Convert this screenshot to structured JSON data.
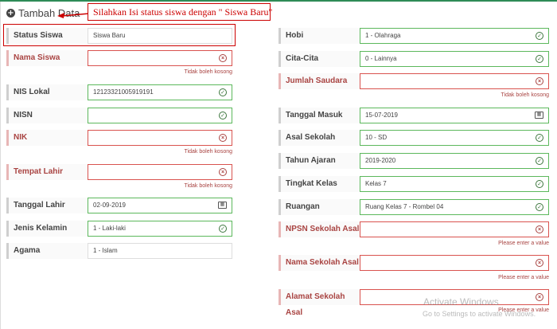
{
  "header": {
    "title": "Tambah Data",
    "icon": "plus-circle-icon"
  },
  "callout": {
    "text": "Silahkan Isi status siswa dengan \" Siswa Baru\""
  },
  "left": {
    "status_siswa": {
      "label": "Status Siswa",
      "value": "Siswa Baru"
    },
    "nama_siswa": {
      "label": "Nama Siswa",
      "value": "",
      "help": "Tidak boleh kosong"
    },
    "nis_lokal": {
      "label": "NIS Lokal",
      "value": "12123321005919191"
    },
    "nisn": {
      "label": "NISN",
      "value": ""
    },
    "nik": {
      "label": "NIK",
      "value": "",
      "help": "Tidak boleh kosong"
    },
    "tempat_lahir": {
      "label": "Tempat Lahir",
      "value": "",
      "help": "Tidak boleh kosong"
    },
    "tanggal_lahir": {
      "label": "Tanggal Lahir",
      "value": "02-09-2019"
    },
    "jenis_kelamin": {
      "label": "Jenis Kelamin",
      "value": "1 - Laki-laki"
    },
    "agama": {
      "label": "Agama",
      "value": "1 - Islam"
    }
  },
  "right": {
    "hobi": {
      "label": "Hobi",
      "value": "1 - Olahraga"
    },
    "cita_cita": {
      "label": "Cita-Cita",
      "value": "0 - Lainnya"
    },
    "jumlah_saudara": {
      "label": "Jumlah Saudara",
      "value": "",
      "help": "Tidak boleh kosong"
    },
    "tanggal_masuk": {
      "label": "Tanggal Masuk",
      "value": "15-07-2019"
    },
    "asal_sekolah": {
      "label": "Asal Sekolah",
      "value": "10 - SD"
    },
    "tahun_ajaran": {
      "label": "Tahun Ajaran",
      "value": "2019-2020"
    },
    "tingkat_kelas": {
      "label": "Tingkat Kelas",
      "value": "Kelas 7"
    },
    "ruangan": {
      "label": "Ruangan",
      "value": "Ruang Kelas 7 - Rombel 04"
    },
    "npsn_sekolah_asal": {
      "label": "NPSN Sekolah Asal",
      "value": "",
      "help": "Please enter a value"
    },
    "nama_sekolah_asal": {
      "label": "Nama Sekolah Asal",
      "value": "",
      "help": "Please enter a value"
    },
    "alamat_sekolah_asal": {
      "label": "Alamat Sekolah Asal",
      "value": "",
      "help": "Please enter a value"
    }
  },
  "watermark": {
    "line1": "Activate Windows",
    "line2": "Go to Settings to activate Windows."
  },
  "colors": {
    "valid": "#5cb85c",
    "error": "#d9534f",
    "accent": "#cc0000"
  }
}
